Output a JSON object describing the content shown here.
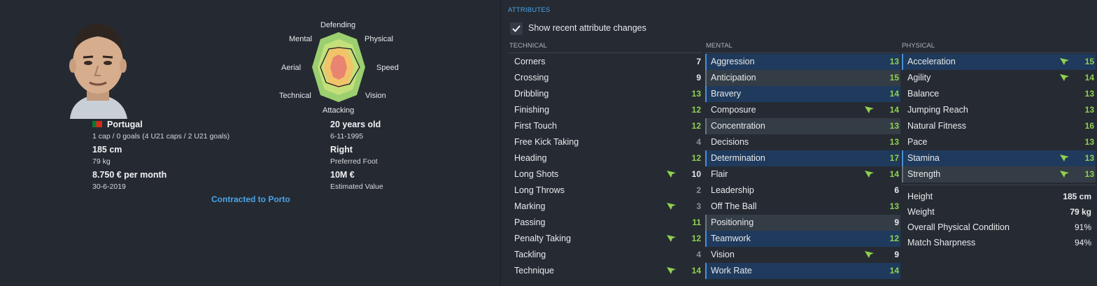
{
  "profile": {
    "nationality": "Portugal",
    "caps_line": "1 cap / 0 goals (4 U21 caps / 2 U21 goals)",
    "height": "185 cm",
    "weight": "79 kg",
    "wage": "8.750 € per month",
    "contract_end": "30-6-2019",
    "age": "20 years old",
    "dob": "6-11-1995",
    "foot": "Right",
    "foot_label": "Preferred Foot",
    "value": "10M €",
    "value_label": "Estimated Value",
    "contract_link": "Contracted to Porto"
  },
  "radar": {
    "labels": {
      "defending": "Defending",
      "physical": "Physical",
      "speed": "Speed",
      "vision": "Vision",
      "attacking": "Attacking",
      "technical": "Technical",
      "aerial": "Aerial",
      "mental": "Mental"
    }
  },
  "attributes": {
    "title": "ATTRIBUTES",
    "show_changes_label": "Show recent attribute changes",
    "show_changes_checked": true,
    "colors": {
      "green": "#8fd14f",
      "white": "#e8eaec",
      "grey": "#8a9099",
      "arrow": "#8fd14f"
    },
    "technical": {
      "header": "TECHNICAL",
      "rows": [
        {
          "name": "Corners",
          "value": "7",
          "color": "white",
          "arrow": false,
          "hl": ""
        },
        {
          "name": "Crossing",
          "value": "9",
          "color": "white",
          "arrow": false,
          "hl": ""
        },
        {
          "name": "Dribbling",
          "value": "13",
          "color": "green",
          "arrow": false,
          "hl": ""
        },
        {
          "name": "Finishing",
          "value": "12",
          "color": "green",
          "arrow": false,
          "hl": ""
        },
        {
          "name": "First Touch",
          "value": "12",
          "color": "green",
          "arrow": false,
          "hl": ""
        },
        {
          "name": "Free Kick Taking",
          "value": "4",
          "color": "grey",
          "arrow": false,
          "hl": ""
        },
        {
          "name": "Heading",
          "value": "12",
          "color": "green",
          "arrow": false,
          "hl": ""
        },
        {
          "name": "Long Shots",
          "value": "10",
          "color": "white",
          "arrow": true,
          "hl": ""
        },
        {
          "name": "Long Throws",
          "value": "2",
          "color": "grey",
          "arrow": false,
          "hl": ""
        },
        {
          "name": "Marking",
          "value": "3",
          "color": "grey",
          "arrow": true,
          "hl": ""
        },
        {
          "name": "Passing",
          "value": "11",
          "color": "green",
          "arrow": false,
          "hl": ""
        },
        {
          "name": "Penalty Taking",
          "value": "12",
          "color": "green",
          "arrow": true,
          "hl": ""
        },
        {
          "name": "Tackling",
          "value": "4",
          "color": "grey",
          "arrow": false,
          "hl": ""
        },
        {
          "name": "Technique",
          "value": "14",
          "color": "green",
          "arrow": true,
          "hl": ""
        }
      ]
    },
    "mental": {
      "header": "MENTAL",
      "rows": [
        {
          "name": "Aggression",
          "value": "13",
          "color": "green",
          "arrow": false,
          "hl": "blue"
        },
        {
          "name": "Anticipation",
          "value": "15",
          "color": "green",
          "arrow": false,
          "hl": "grey"
        },
        {
          "name": "Bravery",
          "value": "14",
          "color": "green",
          "arrow": false,
          "hl": "blue"
        },
        {
          "name": "Composure",
          "value": "14",
          "color": "green",
          "arrow": true,
          "hl": ""
        },
        {
          "name": "Concentration",
          "value": "13",
          "color": "green",
          "arrow": false,
          "hl": "grey"
        },
        {
          "name": "Decisions",
          "value": "13",
          "color": "green",
          "arrow": false,
          "hl": ""
        },
        {
          "name": "Determination",
          "value": "17",
          "color": "green",
          "arrow": false,
          "hl": "blue"
        },
        {
          "name": "Flair",
          "value": "14",
          "color": "green",
          "arrow": true,
          "hl": ""
        },
        {
          "name": "Leadership",
          "value": "6",
          "color": "white",
          "arrow": false,
          "hl": ""
        },
        {
          "name": "Off The Ball",
          "value": "13",
          "color": "green",
          "arrow": false,
          "hl": ""
        },
        {
          "name": "Positioning",
          "value": "9",
          "color": "white",
          "arrow": false,
          "hl": "grey"
        },
        {
          "name": "Teamwork",
          "value": "12",
          "color": "green",
          "arrow": false,
          "hl": "blue"
        },
        {
          "name": "Vision",
          "value": "9",
          "color": "white",
          "arrow": true,
          "hl": ""
        },
        {
          "name": "Work Rate",
          "value": "14",
          "color": "green",
          "arrow": false,
          "hl": "blue"
        }
      ]
    },
    "physical": {
      "header": "PHYSICAL",
      "rows": [
        {
          "name": "Acceleration",
          "value": "15",
          "color": "green",
          "arrow": true,
          "hl": "blue"
        },
        {
          "name": "Agility",
          "value": "14",
          "color": "green",
          "arrow": true,
          "hl": ""
        },
        {
          "name": "Balance",
          "value": "13",
          "color": "green",
          "arrow": false,
          "hl": ""
        },
        {
          "name": "Jumping Reach",
          "value": "13",
          "color": "green",
          "arrow": false,
          "hl": ""
        },
        {
          "name": "Natural Fitness",
          "value": "16",
          "color": "green",
          "arrow": false,
          "hl": ""
        },
        {
          "name": "Pace",
          "value": "13",
          "color": "green",
          "arrow": false,
          "hl": ""
        },
        {
          "name": "Stamina",
          "value": "13",
          "color": "green",
          "arrow": true,
          "hl": "blue"
        },
        {
          "name": "Strength",
          "value": "13",
          "color": "green",
          "arrow": true,
          "hl": "grey"
        }
      ],
      "stats": [
        {
          "name": "Height",
          "value": "185 cm",
          "bold": true
        },
        {
          "name": "Weight",
          "value": "79 kg",
          "bold": true
        },
        {
          "name": "Overall Physical Condition",
          "value": "91%",
          "bold": false
        },
        {
          "name": "Match Sharpness",
          "value": "94%",
          "bold": false
        }
      ]
    }
  }
}
